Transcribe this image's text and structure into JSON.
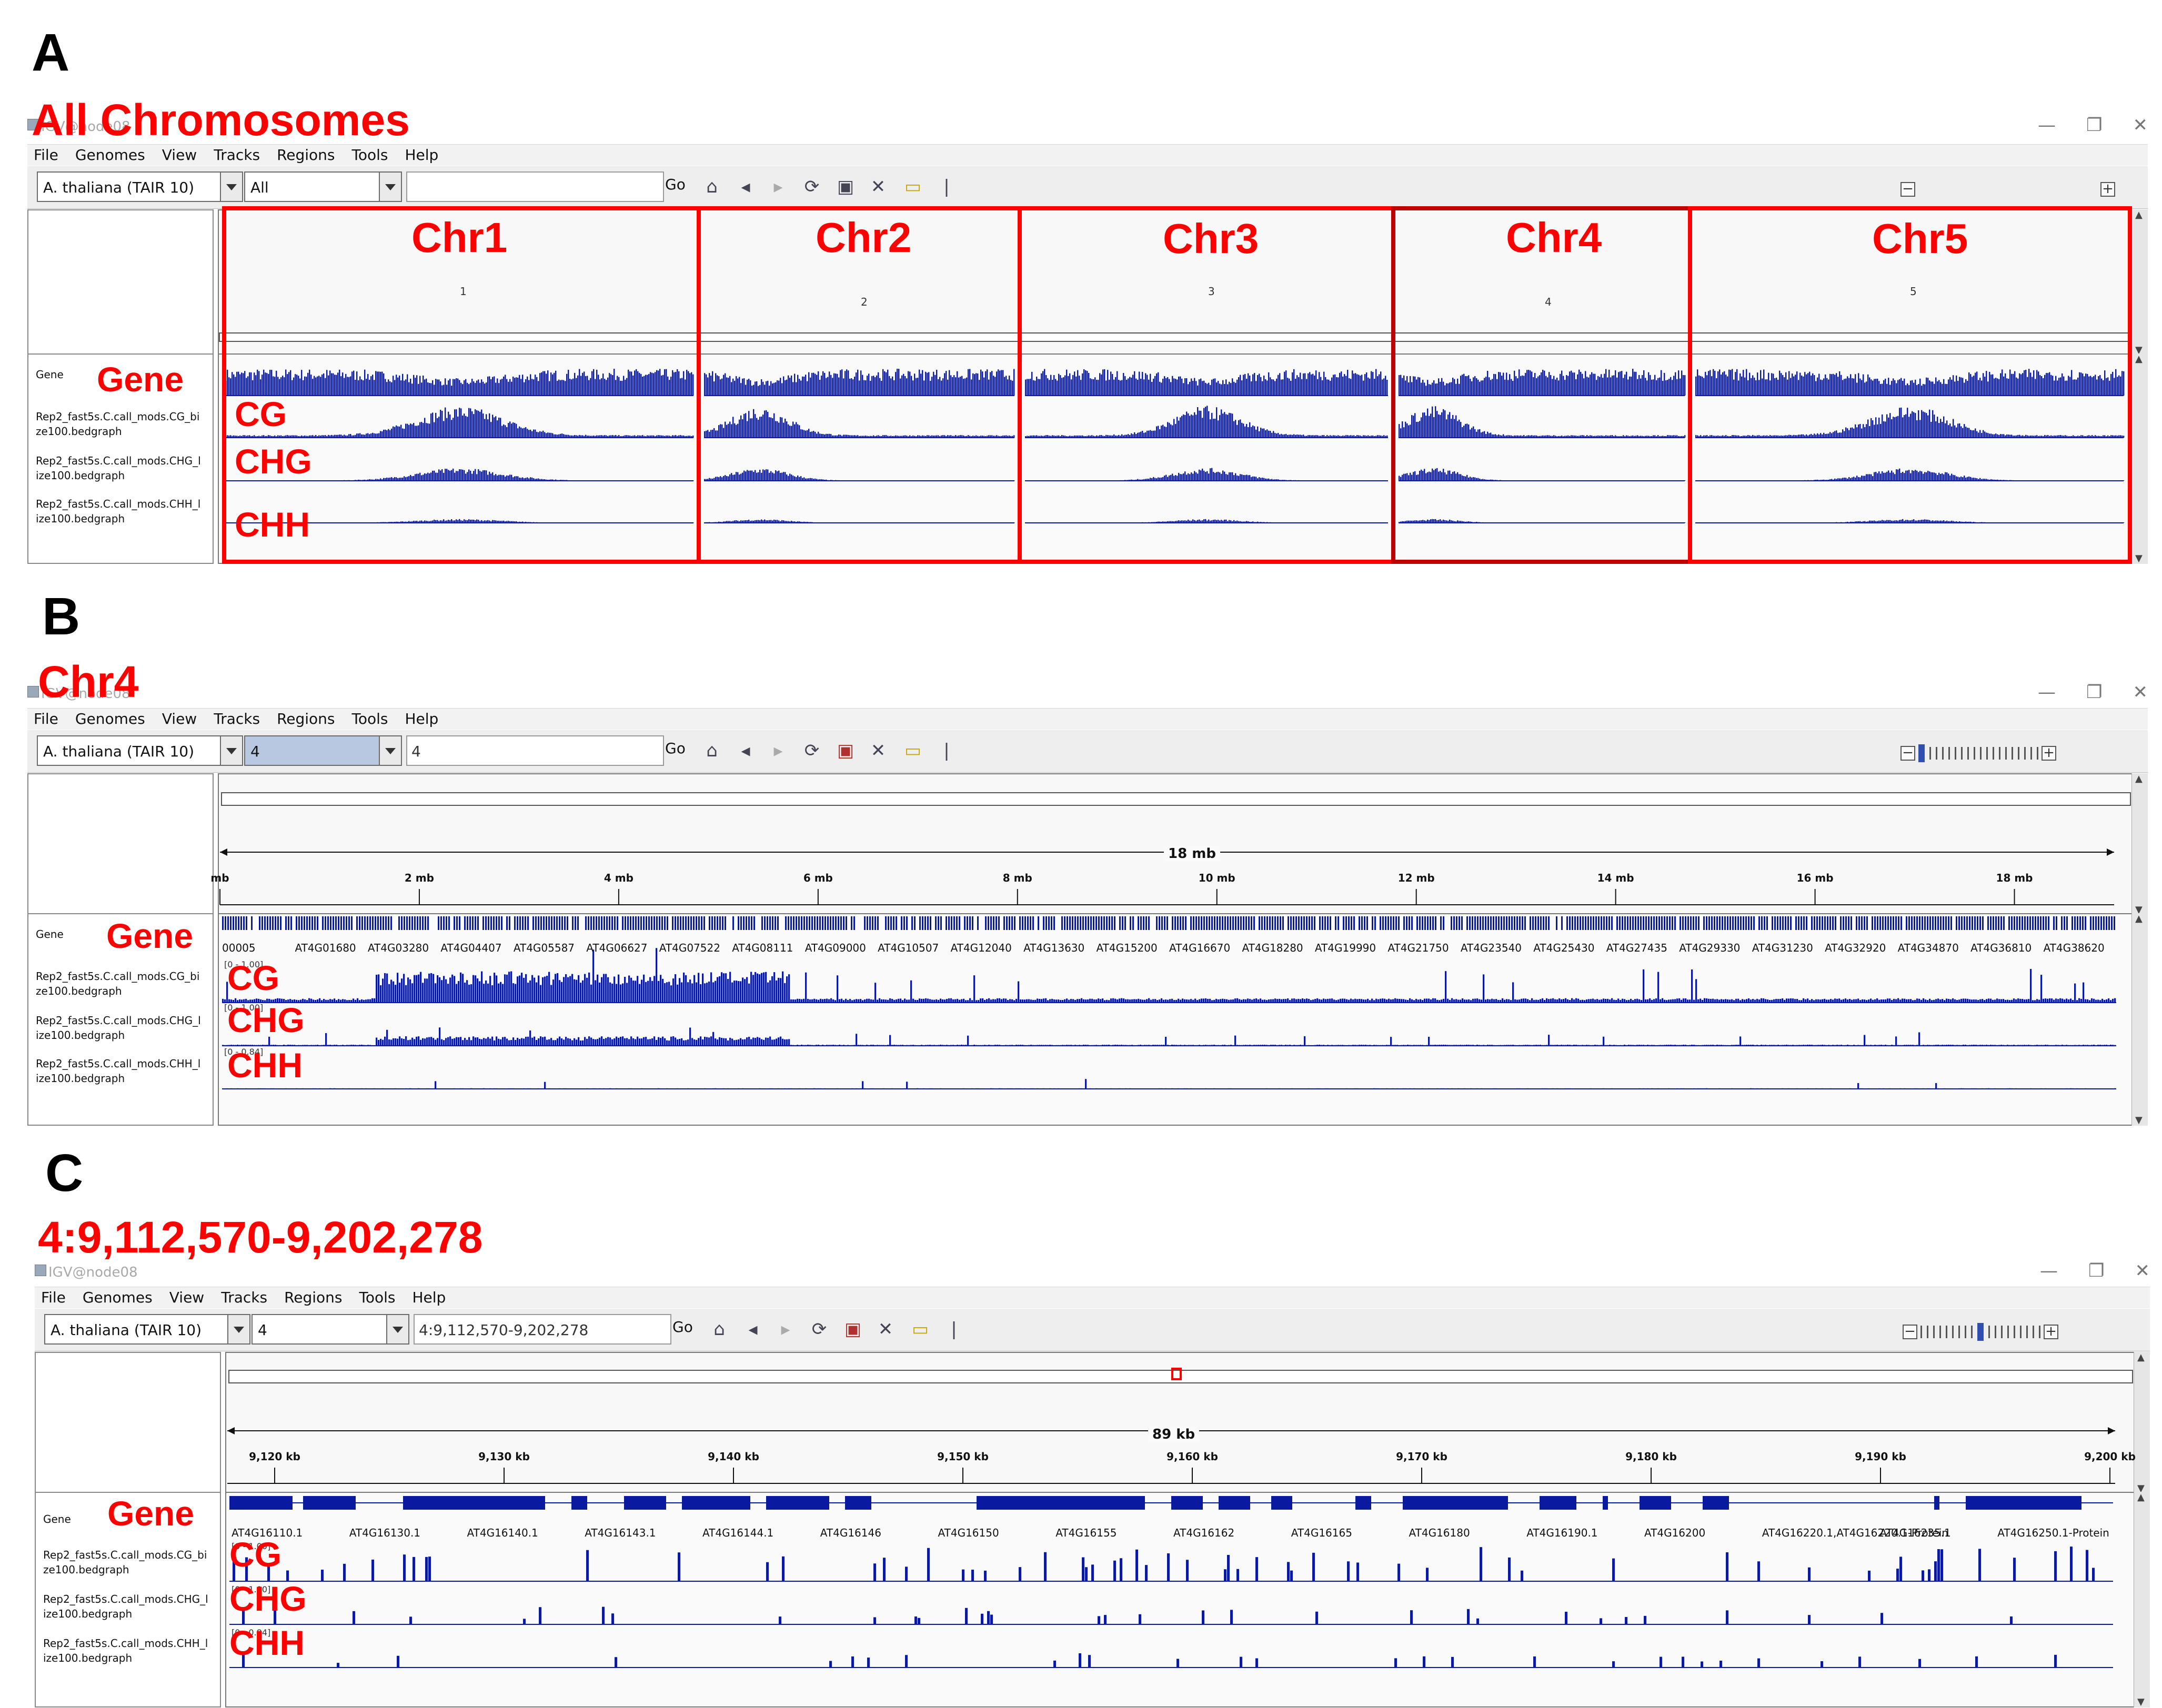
{
  "colors": {
    "annotation_red": "#ff0000",
    "track_blue": "#0a1aa0"
  },
  "panels": [
    {
      "letter": "A",
      "title": "All Chromosomes",
      "window_title": "IGV@node08",
      "menu": [
        "File",
        "Genomes",
        "View",
        "Tracks",
        "Regions",
        "Tools",
        "Help"
      ],
      "genome": "A. thaliana (TAIR 10)",
      "chromosome": "All",
      "locus": "",
      "go_label": "Go",
      "chromosomes": [
        {
          "header": "Chr1",
          "number": "1"
        },
        {
          "header": "Chr2",
          "number": "2"
        },
        {
          "header": "Chr3",
          "number": "3"
        },
        {
          "header": "Chr4",
          "number": "4"
        },
        {
          "header": "Chr5",
          "number": "5"
        }
      ],
      "track_names": [
        "Gene",
        "Rep2_fast5s.C.call_mods.CG_bi\nze100.bedgraph",
        "Rep2_fast5s.C.call_mods.CHG_l\nize100.bedgraph",
        "Rep2_fast5s.C.call_mods.CHH_l\nize100.bedgraph"
      ],
      "track_labels": [
        "Gene",
        "CG",
        "CHG",
        "CHH"
      ]
    },
    {
      "letter": "B",
      "title": "Chr4",
      "window_title": "IGV@node08",
      "menu": [
        "File",
        "Genomes",
        "View",
        "Tracks",
        "Regions",
        "Tools",
        "Help"
      ],
      "genome": "A. thaliana (TAIR 10)",
      "chromosome": "4",
      "locus": "4",
      "go_label": "Go",
      "ruler_span": "18 mb",
      "ruler_ticks": [
        "mb",
        "2 mb",
        "4 mb",
        "6 mb",
        "8 mb",
        "10 mb",
        "12 mb",
        "14 mb",
        "16 mb",
        "18 mb"
      ],
      "genes": [
        "00005",
        "AT4G01680",
        "AT4G03280",
        "AT4G04407",
        "AT4G05587",
        "AT4G06627",
        "AT4G07522",
        "AT4G08111",
        "AT4G09000",
        "AT4G10507",
        "AT4G12040",
        "AT4G13630",
        "AT4G15200",
        "AT4G16670",
        "AT4G18280",
        "AT4G19990",
        "AT4G21750",
        "AT4G23540",
        "AT4G25430",
        "AT4G27435",
        "AT4G29330",
        "AT4G31230",
        "AT4G32920",
        "AT4G34870",
        "AT4G36810",
        "AT4G38620"
      ],
      "ranges": [
        "[0 - 1.00]",
        "[0 - 1.00]",
        "[0 - 0.84]"
      ],
      "track_names": [
        "Gene",
        "Rep2_fast5s.C.call_mods.CG_bi\nze100.bedgraph",
        "Rep2_fast5s.C.call_mods.CHG_l\nize100.bedgraph",
        "Rep2_fast5s.C.call_mods.CHH_l\nize100.bedgraph"
      ],
      "track_labels": [
        "Gene",
        "CG",
        "CHG",
        "CHH"
      ]
    },
    {
      "letter": "C",
      "title": "4:9,112,570-9,202,278",
      "window_title": "IGV@node08",
      "menu": [
        "File",
        "Genomes",
        "View",
        "Tracks",
        "Regions",
        "Tools",
        "Help"
      ],
      "genome": "A. thaliana (TAIR 10)",
      "chromosome": "4",
      "locus": "4:9,112,570-9,202,278",
      "go_label": "Go",
      "ruler_span": "89 kb",
      "ruler_ticks": [
        "9,120 kb",
        "9,130 kb",
        "9,140 kb",
        "9,150 kb",
        "9,160 kb",
        "9,170 kb",
        "9,180 kb",
        "9,190 kb",
        "9,200 kb"
      ],
      "genes": [
        "AT4G16110.1",
        "AT4G16130.1",
        "AT4G16140.1",
        "AT4G16143.1",
        "AT4G16144.1",
        "AT4G16146",
        "AT4G16150",
        "AT4G16155",
        "AT4G16162",
        "AT4G16165",
        "AT4G16180",
        "AT4G16190.1",
        "AT4G16200",
        "AT4G16220.1,AT4G16220.1-Protein",
        "AT4G16235.1",
        "AT4G16250.1-Protein"
      ],
      "ranges": [
        "[0 - 1.00]",
        "[0 - 1.00]",
        "[0 - 0.84]"
      ],
      "track_names": [
        "Gene",
        "Rep2_fast5s.C.call_mods.CG_bi\nze100.bedgraph",
        "Rep2_fast5s.C.call_mods.CHG_l\nize100.bedgraph",
        "Rep2_fast5s.C.call_mods.CHH_l\nize100.bedgraph"
      ],
      "track_labels": [
        "Gene",
        "CG",
        "CHG",
        "CHH"
      ]
    }
  ]
}
